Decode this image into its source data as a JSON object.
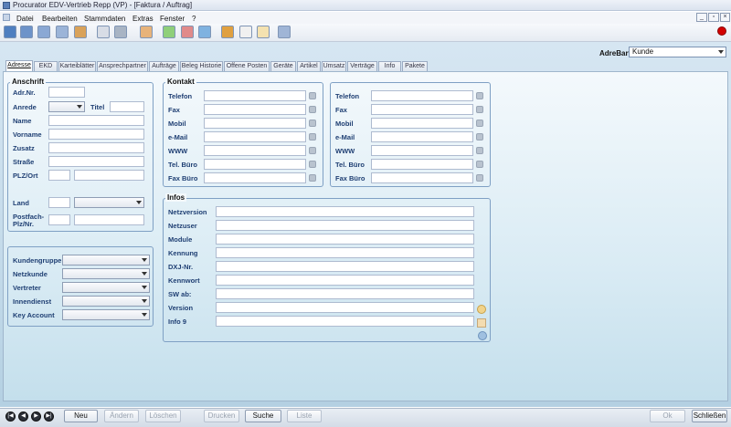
{
  "window": {
    "title": "Procurator EDV-Vertrieb Repp (VP) - [Faktura / Auftrag]"
  },
  "menu": [
    "Datei",
    "Bearbeiten",
    "Stammdaten",
    "Extras",
    "Fenster",
    "?"
  ],
  "toolbar": {
    "icons": [
      "save-icon",
      "doc-icon",
      "print-preview-icon",
      "copy-icon",
      "calc-icon",
      "letter-icon",
      "truck-icon",
      "picture-icon",
      "chart-green-icon",
      "chart-red-icon",
      "transfer-icon",
      "bar-chart-icon",
      "pen-icon",
      "clock-icon",
      "window-icon"
    ]
  },
  "adressart": {
    "label": "AdreBart",
    "value": "Kunde"
  },
  "tabs": [
    "Adresse",
    "EKD",
    "Karteiblätter",
    "Ansprechpartner",
    "Aufträge",
    "Beleg Historie",
    "Offene Posten",
    "Geräte",
    "Artikel",
    "Umsatz",
    "Verträge",
    "Info",
    "Pakete"
  ],
  "anschrift": {
    "title": "Anschrift",
    "adrnr": "Adr.Nr.",
    "anrede": "Anrede",
    "titel": "Titel",
    "name": "Name",
    "vorname": "Vorname",
    "zusatz": "Zusatz",
    "strasse": "Straße",
    "plzort": "PLZ/Ort",
    "land": "Land",
    "postfach1": "Postfach-",
    "postfach2": "Plz/Nr."
  },
  "zuordnung": {
    "kundengruppe": "Kundengruppe",
    "netzkunde": "Netzkunde",
    "vertreter": "Vertreter",
    "innendienst": "Innendienst",
    "keyaccount": "Key Account"
  },
  "kontakt": {
    "title": "Kontakt",
    "labels": [
      "Telefon",
      "Fax",
      "Mobil",
      "e-Mail",
      "WWW",
      "Tel. Büro",
      "Fax Büro"
    ]
  },
  "kontakt2": {
    "labels": [
      "Telefon",
      "Fax",
      "Mobil",
      "e-Mail",
      "WWW",
      "Tel. Büro",
      "Fax Büro"
    ]
  },
  "infos": {
    "title": "Infos",
    "labels": [
      "Netzversion",
      "Netzuser",
      "Module",
      "Kennung",
      "DXJ-Nr.",
      "Kennwort",
      "SW ab:",
      "Version",
      "Info 9"
    ]
  },
  "bottom": {
    "neu": "Neu",
    "aendern": "Ändern",
    "loeschen": "Löschen",
    "drucken": "Drucken",
    "suche": "Suche",
    "liste": "Liste",
    "ok": "Ok",
    "schliessen": "Schließen"
  }
}
